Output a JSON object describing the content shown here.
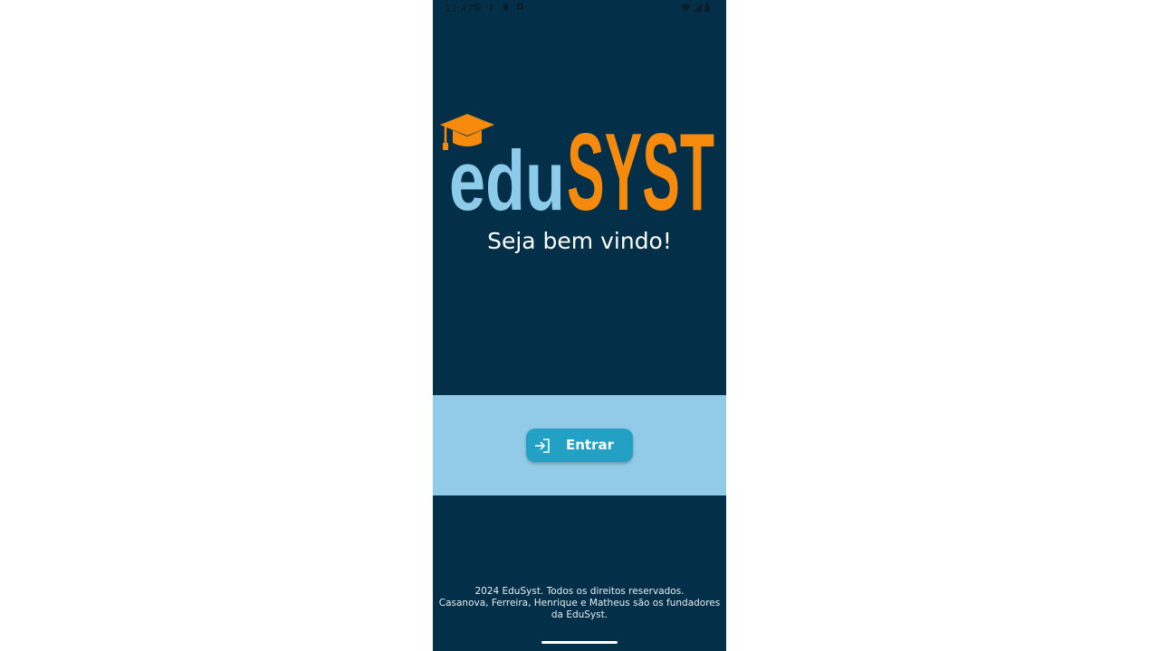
{
  "status_bar": {
    "time": "11:47",
    "left_icons": [
      "do-not-disturb-icon",
      "accessibility-icon",
      "sd-card-icon",
      "settings-icon"
    ],
    "right_icons": [
      "wifi-icon",
      "signal-icon",
      "battery-icon"
    ]
  },
  "logo": {
    "part1": "edu",
    "part2": "SYST",
    "colors": {
      "part1": "#8ccbe9",
      "part2": "#f58a0d",
      "cap": "#f58a0d"
    }
  },
  "welcome": {
    "text": "Seja bem vindo!"
  },
  "login": {
    "button_label": "Entrar",
    "icon": "login-icon"
  },
  "footer": {
    "line1": "2024 EduSyst. Todos os direitos reservados.",
    "line2": "Casanova, Ferreira, Henrique e Matheus são os fundadores",
    "line3": "da EduSyst."
  },
  "colors": {
    "background": "#033048",
    "band": "#92cbe7",
    "button": "#22a1c4",
    "text": "#ffffff"
  }
}
